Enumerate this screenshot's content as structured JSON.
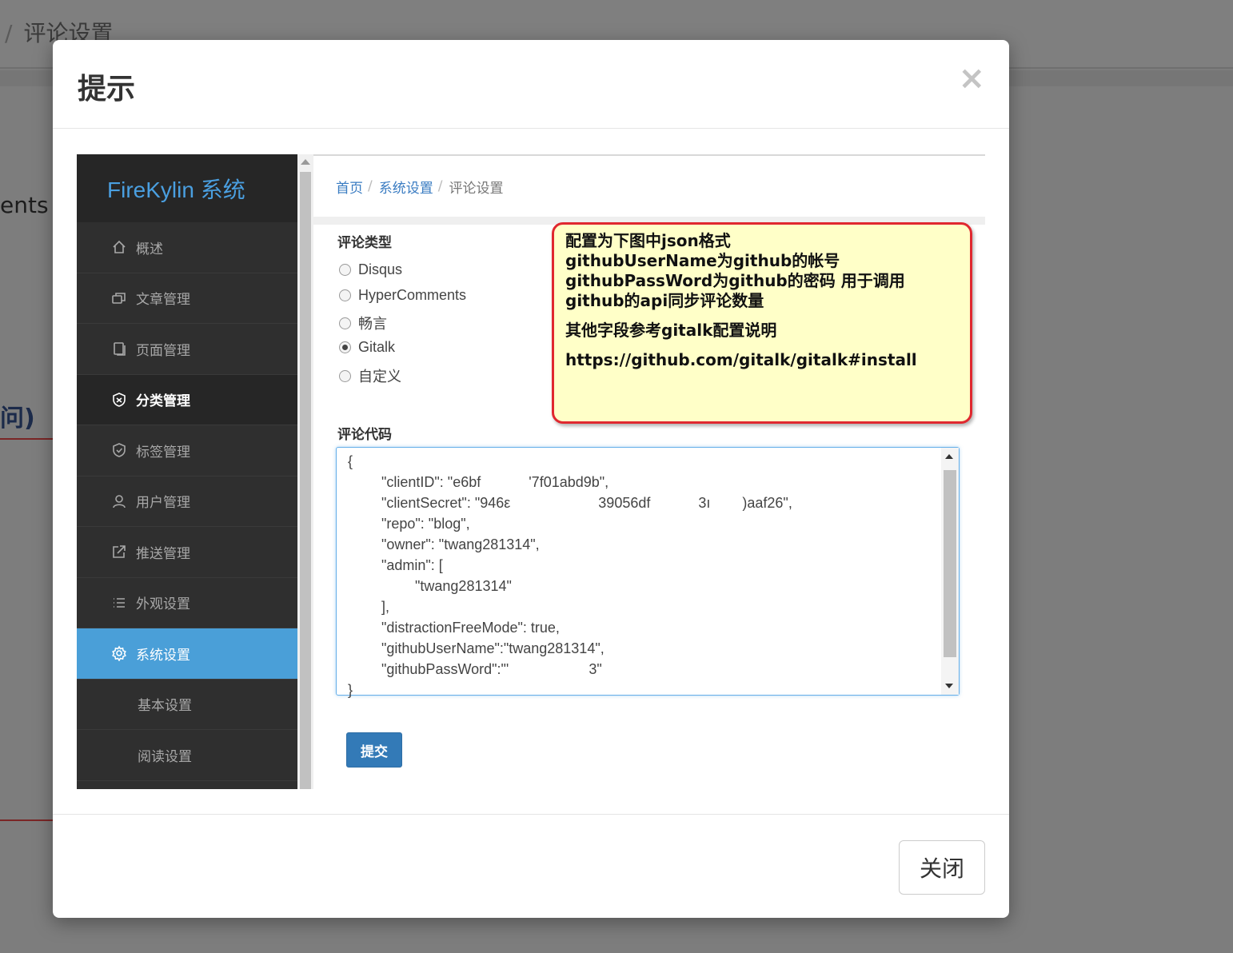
{
  "background": {
    "breadcrumb_sep": "/",
    "breadcrumb_current": "评论设置",
    "fragment_1": "ents",
    "fragment_2": "问)"
  },
  "modal": {
    "title": "提示",
    "close_symbol": "×",
    "close_button_label": "关闭"
  },
  "screenshot": {
    "brand": "FireKylin 系统",
    "nav": [
      {
        "label": "概述",
        "icon": "home-icon"
      },
      {
        "label": "文章管理",
        "icon": "articles-icon"
      },
      {
        "label": "页面管理",
        "icon": "page-icon"
      },
      {
        "label": "分类管理",
        "icon": "shield-icon"
      },
      {
        "label": "标签管理",
        "icon": "tag-shield-icon"
      },
      {
        "label": "用户管理",
        "icon": "user-icon"
      },
      {
        "label": "推送管理",
        "icon": "external-link-icon"
      },
      {
        "label": "外观设置",
        "icon": "list-icon"
      },
      {
        "label": "系统设置",
        "icon": "gear-icon"
      }
    ],
    "subnav": [
      "基本设置",
      "阅读设置"
    ],
    "breadcrumb": {
      "home": "首页",
      "parent": "系统设置",
      "current": "评论设置",
      "sep": "/"
    },
    "comment_type_label": "评论类型",
    "comment_types": [
      "Disqus",
      "HyperComments",
      "畅言",
      "Gitalk",
      "自定义"
    ],
    "selected_type": "Gitalk",
    "comment_code_label": "评论代码",
    "code_lines": [
      "{",
      "    \"clientID\": \"e6bf            '7f01abd9b\",",
      "    \"clientSecret\": \"946ε                      39056df            3ı        )aaf26\",",
      "    \"repo\": \"blog\",",
      "    \"owner\": \"twang281314\",",
      "    \"admin\": [",
      "        \"twang281314\"",
      "    ],",
      "    \"distractionFreeMode\": true,",
      "    \"githubUserName\":\"twang281314\",",
      "    \"githubPassWord\":\"'                    3\"",
      "}"
    ],
    "submit_label": "提交"
  },
  "annotation": {
    "lines": [
      "配置为下图中json格式",
      "githubUserName为github的帐号",
      "githubPassWord为github的密码 用于调用github的api同步评论数量"
    ],
    "line_other": "其他字段参考gitalk配置说明",
    "link": "https://github.com/gitalk/gitalk#install"
  }
}
